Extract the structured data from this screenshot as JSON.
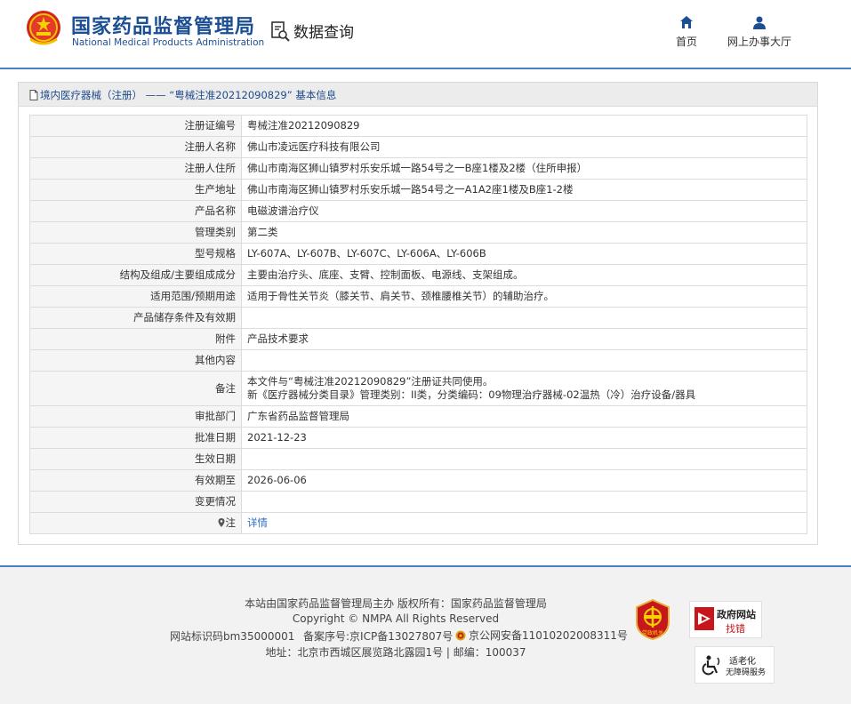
{
  "header": {
    "logo_cn": "国家药品监督管理局",
    "logo_en": "National Medical Products Administration",
    "data_query": "数据查询",
    "nav": {
      "home": "首页",
      "online_hall": "网上办事大厅"
    },
    "colors": {
      "brand": "#1b4f93",
      "accent_line": "#4a7fc4"
    }
  },
  "breadcrumb": "境内医疗器械（注册） —— “粤械注准20212090829” 基本信息",
  "fields": [
    {
      "label": "注册证编号",
      "value": "粤械注准20212090829"
    },
    {
      "label": "注册人名称",
      "value": "佛山市凌远医疗科技有限公司"
    },
    {
      "label": "注册人住所",
      "value": "佛山市南海区狮山镇罗村乐安乐城一路54号之一B座1楼及2楼（住所申报）"
    },
    {
      "label": "生产地址",
      "value": "佛山市南海区狮山镇罗村乐安乐城一路54号之一A1A2座1楼及B座1-2楼"
    },
    {
      "label": "产品名称",
      "value": "电磁波谱治疗仪"
    },
    {
      "label": "管理类别",
      "value": "第二类"
    },
    {
      "label": "型号规格",
      "value": "LY-607A、LY-607B、LY-607C、LY-606A、LY-606B"
    },
    {
      "label": "结构及组成/主要组成成分",
      "value": "主要由治疗头、底座、支臂、控制面板、电源线、支架组成。"
    },
    {
      "label": "适用范围/预期用途",
      "value": "适用于骨性关节炎（膝关节、肩关节、颈椎腰椎关节）的辅助治疗。"
    },
    {
      "label": "产品储存条件及有效期",
      "value": ""
    },
    {
      "label": "附件",
      "value": "产品技术要求"
    },
    {
      "label": "其他内容",
      "value": ""
    }
  ],
  "remark": {
    "label": "备注",
    "line1": "本文件与“粤械注准20212090829”注册证共同使用。",
    "line2": "新《医疗器械分类目录》管理类别：II类，分类编码：09物理治疗器械-02温热（冷）治疗设备/器具"
  },
  "fields2": [
    {
      "label": "审批部门",
      "value": "广东省药品监督管理局"
    },
    {
      "label": "批准日期",
      "value": "2021-12-23"
    },
    {
      "label": "生效日期",
      "value": ""
    },
    {
      "label": "有效期至",
      "value": "2026-06-06"
    },
    {
      "label": "变更情况",
      "value": ""
    }
  ],
  "note": {
    "label": "注",
    "link": "详情"
  },
  "footer": {
    "line1": "本站由国家药品监督管理局主办 版权所有：国家药品监督管理局",
    "line2": "Copyright © NMPA All Rights Reserved",
    "site_id": "网站标识码bm35000001",
    "icp": "备案序号:京ICP备13027807号",
    "police": "京公网安备11010202008311号",
    "address": "地址：北京市西城区展览路北露园1号 | 邮编：100037",
    "badge_red_text": "党政机关",
    "gov_badge_line1": "政府网站",
    "gov_badge_line2": "找错",
    "acc_badge_line1": "适老化",
    "acc_badge_line2": "无障碍服务"
  }
}
